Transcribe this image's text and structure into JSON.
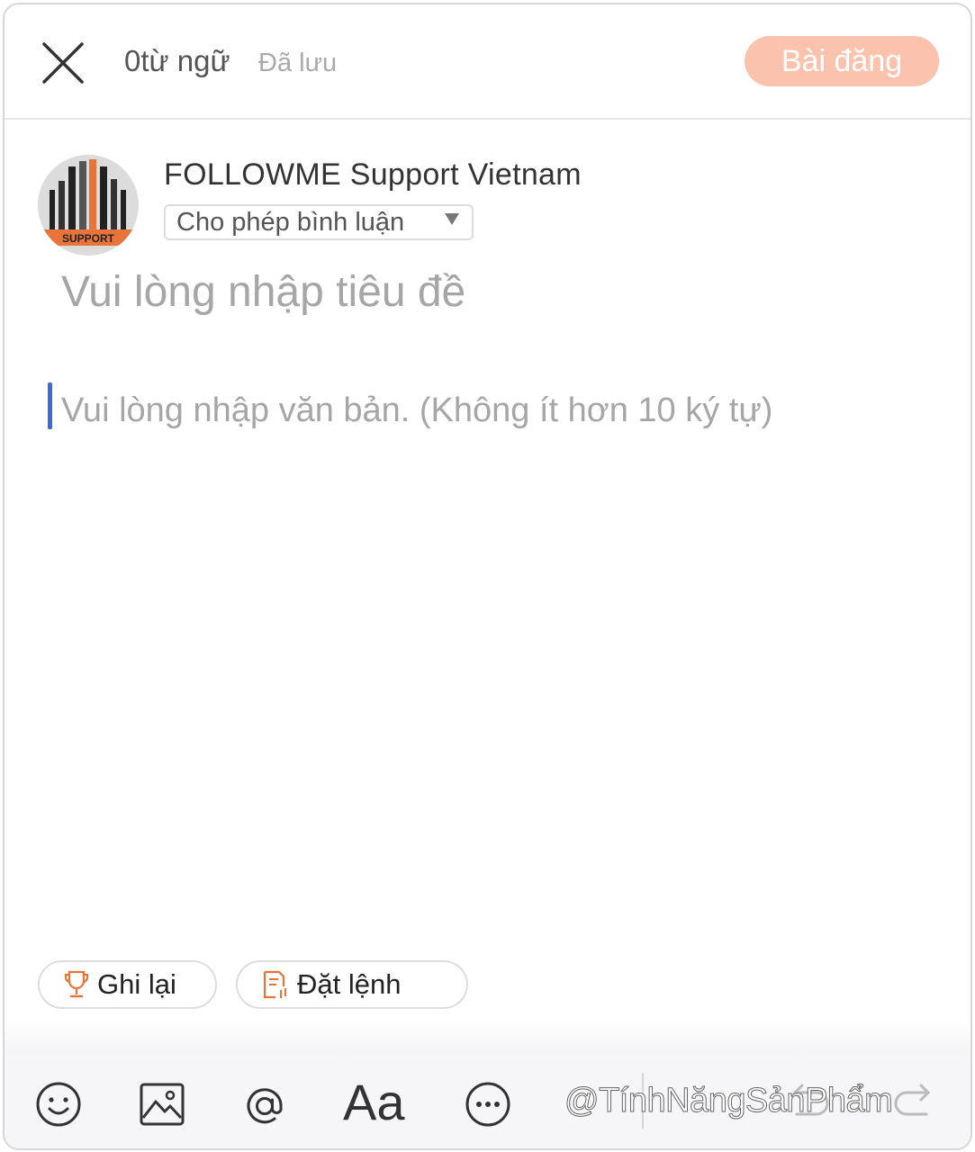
{
  "header": {
    "word_count": "0từ ngữ",
    "save_status": "Đã lưu",
    "post_button": "Bài đăng",
    "post_button_color": "#fbc3ad"
  },
  "author": {
    "name": "FOLLOWME Support Vietnam",
    "avatar_text": "SUPPORT",
    "comment_option": "Cho phép bình luận"
  },
  "editor": {
    "title_placeholder": "Vui lòng nhập tiêu đề",
    "body_placeholder": "Vui lòng nhập văn bản. (Không ít hơn 10 ký tự)",
    "caret_color": "#3d6bd6"
  },
  "chips": [
    {
      "label": "Ghi lại",
      "icon": "trophy-icon"
    },
    {
      "label": "Đặt lệnh",
      "icon": "order-document-icon"
    }
  ],
  "toolbar": {
    "icons": [
      "emoji-icon",
      "image-icon",
      "mention-icon",
      "text-format-icon",
      "more-icon",
      "undo-icon",
      "redo-icon"
    ],
    "text_format_label": "Aa"
  },
  "watermark": "@TínhNăngSảnPhẩm",
  "accent_color": "#e8743b"
}
